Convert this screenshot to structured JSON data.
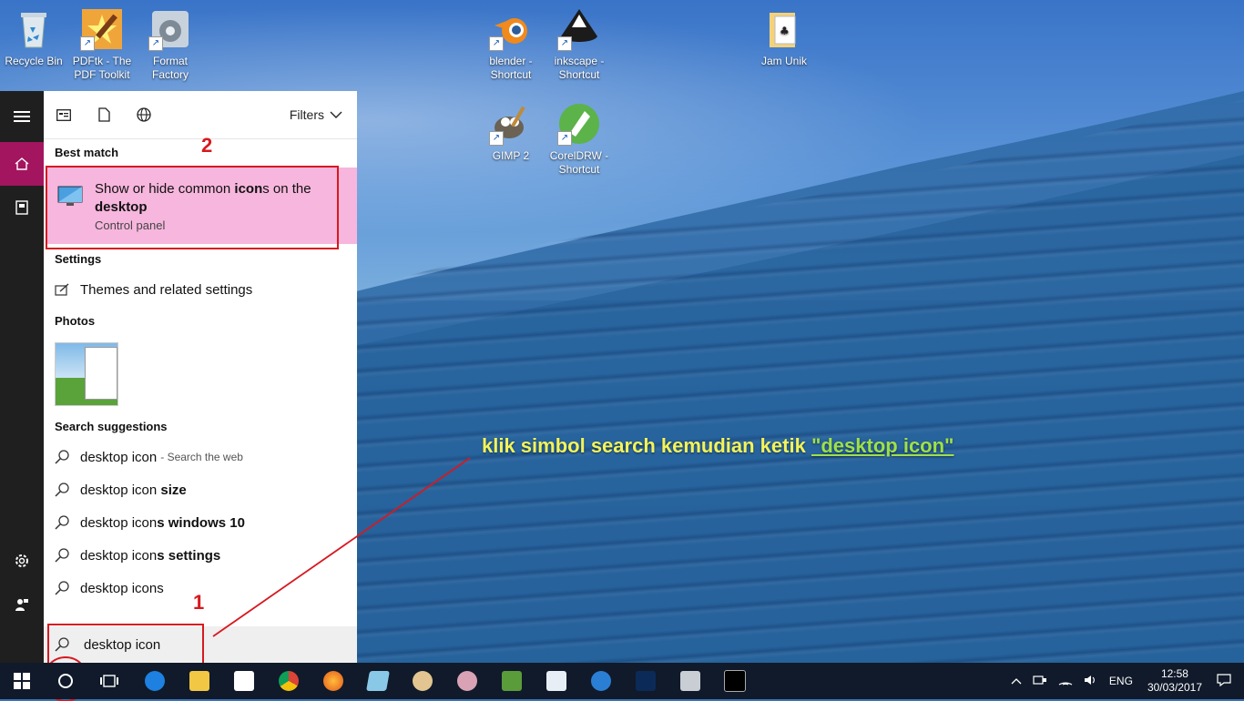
{
  "desktop": {
    "icons": [
      {
        "label": "Recycle Bin",
        "icon": "recycle-bin-icon"
      },
      {
        "label": "PDFtk - The PDF Toolkit",
        "icon": "pdftk-icon"
      },
      {
        "label": "Format Factory",
        "icon": "format-factory-icon"
      },
      {
        "label": "blender - Shortcut",
        "icon": "blender-icon"
      },
      {
        "label": "inkscape - Shortcut",
        "icon": "inkscape-icon"
      },
      {
        "label": "Jam Unik",
        "icon": "folder-icon"
      },
      {
        "label": "GIMP 2",
        "icon": "gimp-icon"
      },
      {
        "label": "CorelDRW - Shortcut",
        "icon": "coreldraw-icon"
      }
    ]
  },
  "start_menu": {
    "filters_label": "Filters",
    "best_match": {
      "section_title": "Best match",
      "title_parts": [
        "Show or hide common ",
        "icon",
        "s on the ",
        "desktop"
      ],
      "subtitle": "Control panel"
    },
    "settings": {
      "section_title": "Settings",
      "item": "Themes and related settings"
    },
    "photos": {
      "section_title": "Photos"
    },
    "suggestions": {
      "section_title": "Search suggestions",
      "items": [
        {
          "base": "desktop icon",
          "rest": "",
          "note": " - Search the web"
        },
        {
          "base": "desktop icon ",
          "rest": "size",
          "note": ""
        },
        {
          "base": "desktop icon",
          "rest": "s windows 10",
          "note": ""
        },
        {
          "base": "desktop icon",
          "rest": "s settings",
          "note": ""
        },
        {
          "base": "desktop icon",
          "rest": "s",
          "note": ""
        }
      ]
    },
    "search_value": "desktop icon"
  },
  "annotations": {
    "num1": "1",
    "num2": "2",
    "caption_text": "klik simbol search kemudian ketik ",
    "caption_highlight": "\"desktop icon\""
  },
  "taskbar": {
    "tray": {
      "language": "ENG",
      "time": "12:58",
      "date": "30/03/2017"
    },
    "apps": [
      "edge-icon",
      "file-explorer-icon",
      "store-icon",
      "chrome-icon",
      "firefox-icon",
      "app-icon",
      "paint-icon",
      "paint-alt-icon",
      "app-green-icon",
      "app-doc-icon",
      "app-blue-icon",
      "photoshop-icon",
      "app-gray-icon",
      "cmd-icon"
    ]
  },
  "colors": {
    "accent": "#a3155f",
    "best_match_bg": "#f7b6dd",
    "annotation_red": "#d71920",
    "caption_yellow": "#f3f35a"
  }
}
